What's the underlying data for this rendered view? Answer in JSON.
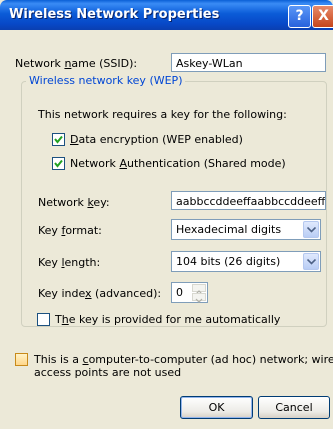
{
  "window": {
    "title": "Wireless Network Properties",
    "help_label": "?",
    "close_label": "X"
  },
  "ssid": {
    "label_pre": "Network ",
    "label_u": "n",
    "label_post": "ame (SSID):",
    "value": "Askey-WLan"
  },
  "wep_group": {
    "legend": "Wireless network key (WEP)",
    "intro": "This network requires a key for the following:",
    "data_encryption": {
      "checked": true,
      "label_u": "D",
      "label_post": "ata encryption (WEP enabled)"
    },
    "network_auth": {
      "checked": true,
      "label_pre": "Network ",
      "label_u": "A",
      "label_post": "uthentication (Shared mode)"
    },
    "network_key": {
      "label_pre": "Network ",
      "label_u": "k",
      "label_post": "ey:",
      "value": "aabbccddeeffaabbccddeeff"
    },
    "key_format": {
      "label_pre": "Key ",
      "label_u": "f",
      "label_post": "ormat:",
      "value": "Hexadecimal digits"
    },
    "key_length": {
      "label_pre": "Key ",
      "label_u": "l",
      "label_post": "ength:",
      "value": "104 bits (26 digits)"
    },
    "key_index": {
      "label_pre": "Key inde",
      "label_u": "x",
      "label_post": " (advanced):",
      "value": "0"
    },
    "auto_key": {
      "checked": false,
      "label_pre": "T",
      "label_u": "h",
      "label_post": "e key is provided for me automatically"
    }
  },
  "adhoc": {
    "checked": false,
    "line1_pre": "This is a ",
    "line1_u": "c",
    "line1_post": "omputer-to-computer (ad hoc) network; wireless",
    "line2": "access points are not used"
  },
  "buttons": {
    "ok": "OK",
    "cancel": "Cancel"
  }
}
